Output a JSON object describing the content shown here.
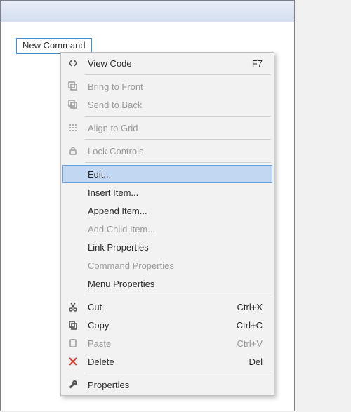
{
  "design_surface": {
    "new_command_label": "New Command"
  },
  "menu": [
    {
      "label": "View Code",
      "shortcut": "F7",
      "icon": "code-icon",
      "enabled": true
    },
    "sep",
    {
      "label": "Bring to Front",
      "icon": "bring-to-front-icon",
      "enabled": false
    },
    {
      "label": "Send to Back",
      "icon": "send-to-back-icon",
      "enabled": false
    },
    "sep",
    {
      "label": "Align to Grid",
      "icon": "align-grid-icon",
      "enabled": false
    },
    "sep",
    {
      "label": "Lock Controls",
      "icon": "lock-icon",
      "enabled": false
    },
    "sep",
    {
      "label": "Edit...",
      "enabled": true,
      "highlight": true
    },
    {
      "label": "Insert Item...",
      "enabled": true
    },
    {
      "label": "Append Item...",
      "enabled": true
    },
    {
      "label": "Add Child Item...",
      "enabled": false
    },
    {
      "label": "Link Properties",
      "enabled": true
    },
    {
      "label": "Command Properties",
      "enabled": false
    },
    {
      "label": "Menu Properties",
      "enabled": true
    },
    "sep",
    {
      "label": "Cut",
      "shortcut": "Ctrl+X",
      "icon": "cut-icon",
      "enabled": true
    },
    {
      "label": "Copy",
      "shortcut": "Ctrl+C",
      "icon": "copy-icon",
      "enabled": true
    },
    {
      "label": "Paste",
      "shortcut": "Ctrl+V",
      "icon": "paste-icon",
      "enabled": false
    },
    {
      "label": "Delete",
      "shortcut": "Del",
      "icon": "delete-icon",
      "enabled": true
    },
    "sep",
    {
      "label": "Properties",
      "icon": "wrench-icon",
      "enabled": true
    }
  ]
}
